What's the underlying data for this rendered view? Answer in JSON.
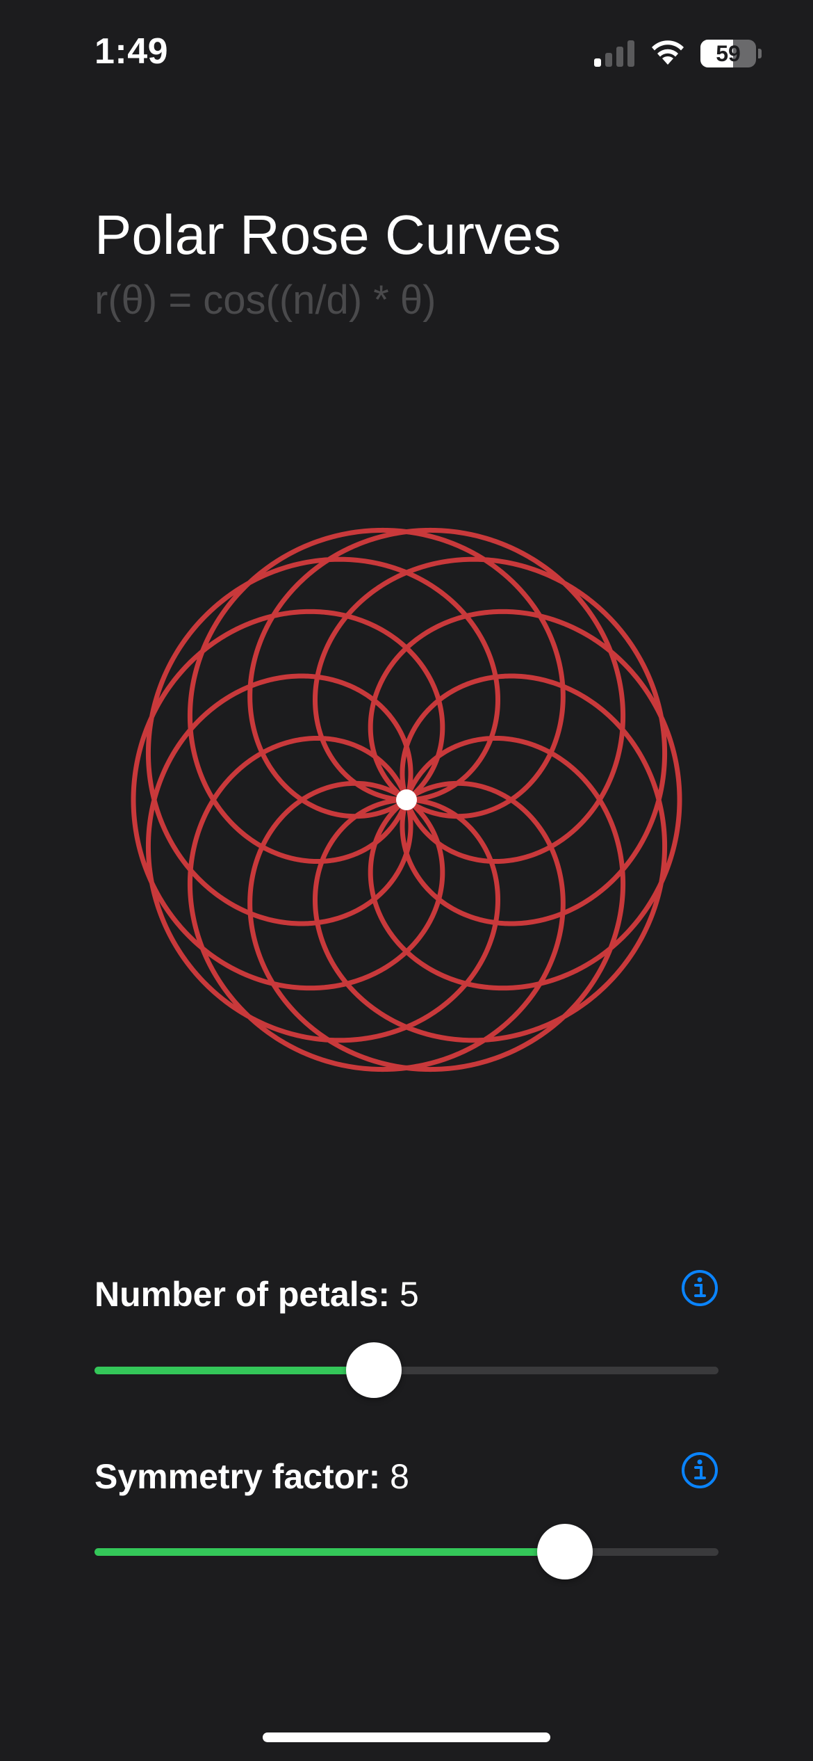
{
  "status_bar": {
    "time": "1:49",
    "battery_level": "59",
    "battery_fraction": 0.59,
    "signal_icon": "cellular-signal-icon",
    "wifi_icon": "wifi-icon"
  },
  "header": {
    "title": "Polar Rose Curves",
    "subtitle": "r(θ) = cos((n/d) * θ)"
  },
  "rose": {
    "n": 5,
    "d": 8,
    "curve_color": "#c9393b",
    "center_dot_color": "#ffffff"
  },
  "controls": {
    "petals": {
      "label": "Number of petals:",
      "value": "5",
      "fraction": 0.448,
      "info_icon": "info-circle-icon"
    },
    "symmetry": {
      "label": "Symmetry factor:",
      "value": "8",
      "fraction": 0.754,
      "info_icon": "info-circle-icon"
    }
  },
  "colors": {
    "background": "#1c1c1e",
    "accent_green": "#34c759",
    "accent_blue": "#0a84ff",
    "track": "#3a3a3c",
    "subtitle": "#4a4a4c"
  }
}
